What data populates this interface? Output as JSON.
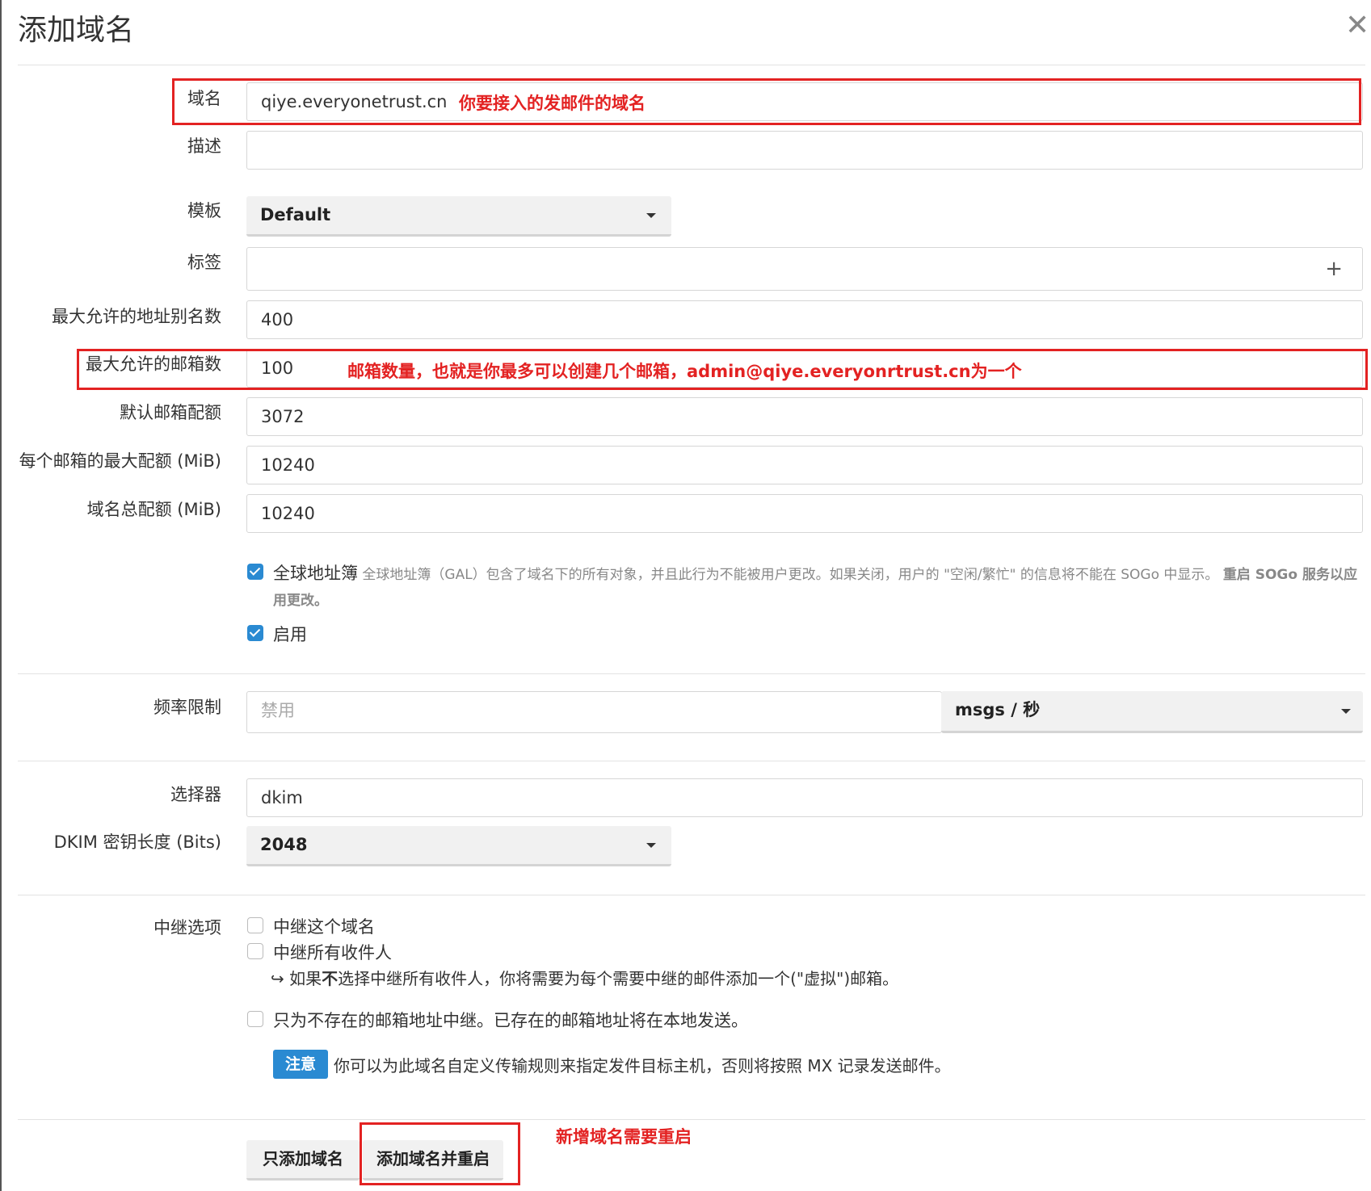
{
  "modal": {
    "title": "添加域名",
    "close_icon": "close-icon"
  },
  "fields": {
    "domain": {
      "label": "域名",
      "value": "qiye.everyonetrust.cn"
    },
    "description": {
      "label": "描述",
      "value": ""
    },
    "template": {
      "label": "模板",
      "value": "Default"
    },
    "tags": {
      "label": "标签",
      "add_icon": "plus-icon"
    },
    "max_aliases": {
      "label": "最大允许的地址别名数",
      "value": "400"
    },
    "max_mailboxes": {
      "label": "最大允许的邮箱数",
      "value": "100"
    },
    "default_quota": {
      "label": "默认邮箱配额",
      "value": "3072"
    },
    "max_quota_per_mailbox": {
      "label": "每个邮箱的最大配额 (MiB)",
      "value": "10240"
    },
    "domain_total_quota": {
      "label": "域名总配额 (MiB)",
      "value": "10240"
    }
  },
  "gal": {
    "checked": true,
    "label": "全球地址簿",
    "help": "全球地址簿（GAL）包含了域名下的所有对象，并且此行为不能被用户更改。如果关闭，用户的 \"空闲/繁忙\" 的信息将不能在 SOGo 中显示。",
    "help_bold": "重启 SOGo 服务以应用更改。"
  },
  "active": {
    "checked": true,
    "label": "启用"
  },
  "rate_limit": {
    "label": "频率限制",
    "placeholder": "禁用",
    "unit": "msgs / 秒"
  },
  "dkim": {
    "selector_label": "选择器",
    "selector_value": "dkim",
    "key_length_label": "DKIM 密钥长度 (Bits)",
    "key_length_value": "2048"
  },
  "relay": {
    "label": "中继选项",
    "relay_domain": {
      "checked": false,
      "label": "中继这个域名"
    },
    "relay_all": {
      "checked": false,
      "label": "中继所有收件人"
    },
    "relay_all_hint": "如果不选择中继所有收件人，你将需要为每个需要中继的邮件添加一个(\"虚拟\")邮箱。",
    "relay_all_hint_prefix": "如果",
    "relay_all_hint_bold": "不",
    "relay_all_hint_suffix": "选择中继所有收件人，你将需要为每个需要中继的邮件添加一个(\"虚拟\")邮箱。",
    "relay_unknown": {
      "checked": false,
      "label": "只为不存在的邮箱地址中继。已存在的邮箱地址将在本地发送。"
    },
    "note_badge": "注意",
    "note_text": "你可以为此域名自定义传输规则来指定发件目标主机，否则将按照 MX 记录发送邮件。"
  },
  "buttons": {
    "add_only": "只添加域名",
    "add_restart": "添加域名并重启"
  },
  "annotations": {
    "domain": "你要接入的发邮件的域名",
    "mailboxes": "邮箱数量，也就是你最多可以创建几个邮箱，admin@qiye.everyonrtrust.cn为一个",
    "restart": "新增域名需要重启",
    "color": "#e32222"
  }
}
